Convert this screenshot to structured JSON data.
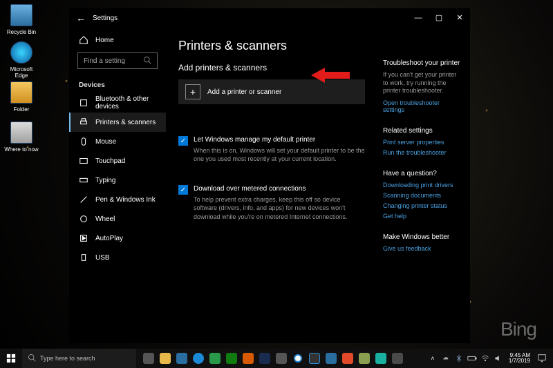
{
  "desktop": {
    "recycle_bin": "Recycle Bin",
    "edge": "Microsoft Edge",
    "folder": "Folder",
    "where": "Where to now"
  },
  "bing_watermark": "Bing",
  "window": {
    "title": "Settings",
    "titlebar": {
      "min": "—",
      "max": "▢",
      "close": "✕",
      "back": "←"
    },
    "sidebar": {
      "home_label": "Home",
      "search_placeholder": "Find a setting",
      "category_header": "Devices",
      "items": [
        {
          "label": "Bluetooth & other devices"
        },
        {
          "label": "Printers & scanners",
          "selected": true
        },
        {
          "label": "Mouse"
        },
        {
          "label": "Touchpad"
        },
        {
          "label": "Typing"
        },
        {
          "label": "Pen & Windows Ink"
        },
        {
          "label": "Wheel"
        },
        {
          "label": "AutoPlay"
        },
        {
          "label": "USB"
        }
      ]
    },
    "main": {
      "heading": "Printers & scanners",
      "subheading": "Add printers & scanners",
      "add_button": "Add a printer or scanner",
      "check1_label": "Let Windows manage my default printer",
      "check1_desc": "When this is on, Windows will set your default printer to be the one you used most recently at your current location.",
      "check2_label": "Download over metered connections",
      "check2_desc": "To help prevent extra charges, keep this off so device software (drivers, info, and apps) for new devices won't download while you're on metered Internet connections."
    },
    "right": {
      "troubleshoot_head": "Troubleshoot your printer",
      "troubleshoot_text": "If you can't get your printer to work, try running the printer troubleshooter.",
      "troubleshoot_link": "Open troubleshooter settings",
      "related_head": "Related settings",
      "related_links": [
        "Print server properties",
        "Run the troubleshooter"
      ],
      "question_head": "Have a question?",
      "question_links": [
        "Downloading print drivers",
        "Scanning documents",
        "Changing printer status",
        "Get help"
      ],
      "feedback_head": "Make Windows better",
      "feedback_link": "Give us feedback"
    }
  },
  "taskbar": {
    "search_placeholder": "Type here to search",
    "time": "9:45 AM",
    "date": "1/7/2019"
  }
}
